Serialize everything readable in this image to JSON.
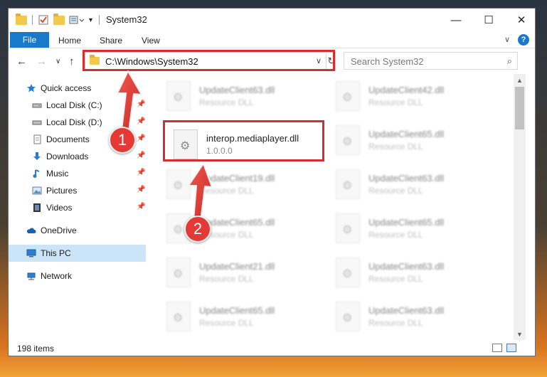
{
  "window": {
    "title": "System32",
    "minimize": "—",
    "maximize": "☐",
    "close": "✕"
  },
  "ribbon": {
    "tabs": [
      "File",
      "Home",
      "Share",
      "View"
    ],
    "expand": "∨",
    "help": "?"
  },
  "nav": {
    "back": "←",
    "forward": "→",
    "recent": "∨",
    "up": "↑",
    "address": "C:\\Windows\\System32",
    "address_dropdown": "∨",
    "refresh": "↻",
    "search_placeholder": "Search System32",
    "search_icon": "⌕"
  },
  "sidebar": {
    "items": [
      {
        "label": "Quick access",
        "icon": "star-icon"
      },
      {
        "label": "Local Disk (C:)",
        "icon": "drive-icon",
        "pinned": true
      },
      {
        "label": "Local Disk (D:)",
        "icon": "drive-icon",
        "pinned": true
      },
      {
        "label": "Documents",
        "icon": "documents-icon",
        "pinned": true
      },
      {
        "label": "Downloads",
        "icon": "downloads-icon",
        "pinned": true
      },
      {
        "label": "Music",
        "icon": "music-icon",
        "pinned": true
      },
      {
        "label": "Pictures",
        "icon": "pictures-icon",
        "pinned": true
      },
      {
        "label": "Videos",
        "icon": "videos-icon",
        "pinned": true
      },
      {
        "label": "OneDrive",
        "icon": "cloud-icon"
      },
      {
        "label": "This PC",
        "icon": "computer-icon",
        "selected": true
      },
      {
        "label": "Network",
        "icon": "network-icon"
      }
    ]
  },
  "files": {
    "left": [
      {
        "name": "UpdateClient63.dll",
        "desc": "Resource DLL"
      },
      {
        "name": "interop.mediaplayer.dll",
        "desc": "1.0.0.0"
      },
      {
        "name": "UpdateClient19.dll",
        "desc": "Resource DLL"
      },
      {
        "name": "UpdateClient65.dll",
        "desc": "Resource DLL"
      },
      {
        "name": "UpdateClient21.dll",
        "desc": "Resource DLL"
      },
      {
        "name": "UpdateClient65.dll",
        "desc": "Resource DLL"
      }
    ],
    "right": [
      {
        "name": "UpdateClient42.dll",
        "desc": "Resource DLL"
      },
      {
        "name": "UpdateClient65.dll",
        "desc": "Resource DLL"
      },
      {
        "name": "UpdateClient63.dll",
        "desc": "Resource DLL"
      },
      {
        "name": "UpdateClient65.dll",
        "desc": "Resource DLL"
      },
      {
        "name": "UpdateClient63.dll",
        "desc": "Resource DLL"
      },
      {
        "name": "UpdateClient63.dll",
        "desc": "Resource DLL"
      }
    ]
  },
  "status": {
    "item_count": "198 items"
  },
  "annotations": {
    "step1": "1",
    "step2": "2",
    "color": "#d32f2f"
  }
}
